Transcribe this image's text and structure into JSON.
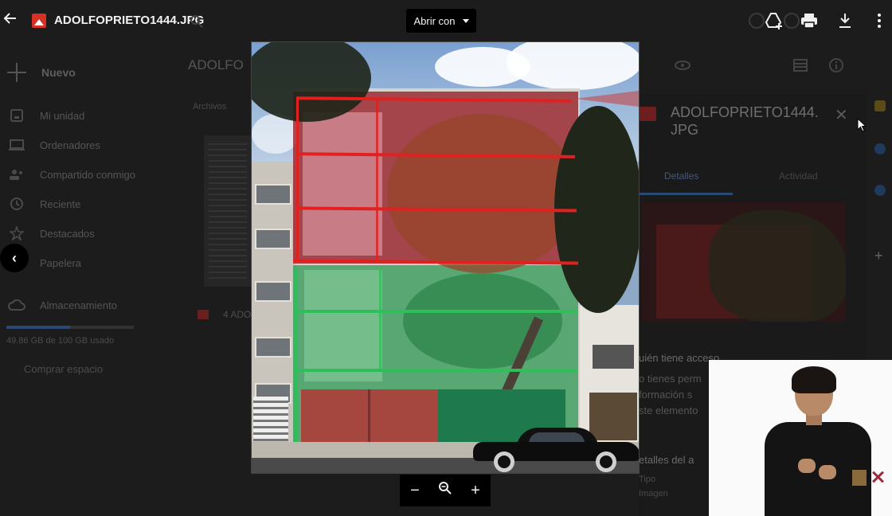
{
  "viewer": {
    "file_name": "ADOLFOPRIETO1444.JPG",
    "open_with_label": "Abrir con"
  },
  "drive": {
    "new_label": "Nuevo",
    "nav": [
      {
        "label": "Mi unidad",
        "icon": "drive-icon"
      },
      {
        "label": "Ordenadores",
        "icon": "computer-icon"
      },
      {
        "label": "Compartido conmigo",
        "icon": "people-icon"
      },
      {
        "label": "Reciente",
        "icon": "clock-icon"
      },
      {
        "label": "Destacados",
        "icon": "star-icon"
      },
      {
        "label": "Papelera",
        "icon": "trash-icon"
      }
    ],
    "storage_label": "Almacenamiento",
    "storage_text": "49.86 GB de 100 GB usado",
    "storage_fraction": 0.4986,
    "buy_label": "Comprar espacio",
    "folder_title": "ADOLFO",
    "files_tab": "Archivos",
    "file_row": "4 ADO"
  },
  "details": {
    "title": "ADOLFOPRIETO1444.JPG",
    "tab_details": "Detalles",
    "tab_activity": "Actividad",
    "access_heading": "uién tiene acceso",
    "access_text_1": "o tienes perm",
    "access_text_2": "formación s",
    "access_text_3": "ste elemento",
    "file_details_heading": "etalles del a",
    "type_label": "Tipo",
    "type_value": "Imagen"
  },
  "zoom": {
    "minus": "−",
    "plus": "+"
  },
  "colors": {
    "red_highlight": "#e0211f",
    "green_highlight": "#2fbf5a",
    "file_icon": "#d93025"
  }
}
